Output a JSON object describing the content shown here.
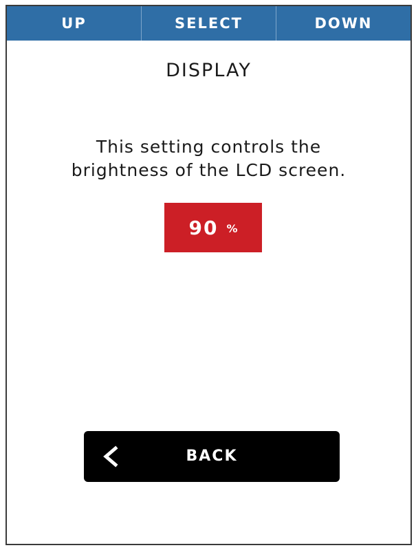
{
  "topbar": {
    "up_label": "UP",
    "select_label": "SELECT",
    "down_label": "DOWN"
  },
  "screen": {
    "title": "DISPLAY",
    "description_line1": "This setting controls the",
    "description_line2": "brightness of the LCD screen."
  },
  "brightness": {
    "value": "90",
    "unit": "%"
  },
  "back_button": {
    "label": "BACK",
    "icon": "chevron-left-icon"
  },
  "colors": {
    "topbar": "#2f6ea6",
    "value_box": "#cc1f26",
    "back_button": "#000000"
  }
}
